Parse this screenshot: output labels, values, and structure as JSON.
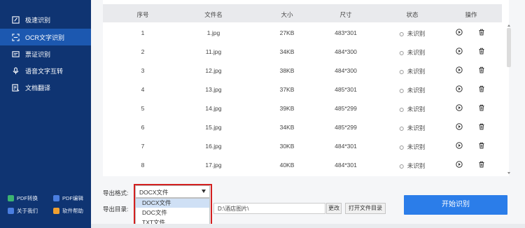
{
  "sidebar": {
    "items": [
      {
        "label": "极速识别",
        "icon": "edit-icon"
      },
      {
        "label": "OCR文字识别",
        "icon": "scan-icon"
      },
      {
        "label": "票证识别",
        "icon": "ticket-icon"
      },
      {
        "label": "语音文字互转",
        "icon": "mic-icon"
      },
      {
        "label": "文档翻译",
        "icon": "translate-icon"
      }
    ],
    "active_index": 1,
    "bottom_links": [
      {
        "label": "PDF转换",
        "color": "#3cb371"
      },
      {
        "label": "PDF编辑",
        "color": "#4a7ee0"
      },
      {
        "label": "关于我们",
        "color": "#4a7ee0"
      },
      {
        "label": "软件帮助",
        "color": "#f0a030"
      }
    ]
  },
  "table": {
    "headers": [
      "序号",
      "文件名",
      "大小",
      "尺寸",
      "状态",
      "操作"
    ],
    "rows": [
      {
        "index": "1",
        "name": "1.jpg",
        "size": "27KB",
        "dim": "483*301",
        "status": "未识别"
      },
      {
        "index": "2",
        "name": "11.jpg",
        "size": "34KB",
        "dim": "484*300",
        "status": "未识别"
      },
      {
        "index": "3",
        "name": "12.jpg",
        "size": "38KB",
        "dim": "484*300",
        "status": "未识别"
      },
      {
        "index": "4",
        "name": "13.jpg",
        "size": "37KB",
        "dim": "485*301",
        "status": "未识别"
      },
      {
        "index": "5",
        "name": "14.jpg",
        "size": "39KB",
        "dim": "485*299",
        "status": "未识别"
      },
      {
        "index": "6",
        "name": "15.jpg",
        "size": "34KB",
        "dim": "485*299",
        "status": "未识别"
      },
      {
        "index": "7",
        "name": "16.jpg",
        "size": "30KB",
        "dim": "484*301",
        "status": "未识别"
      },
      {
        "index": "8",
        "name": "17.jpg",
        "size": "40KB",
        "dim": "484*301",
        "status": "未识别"
      }
    ]
  },
  "export": {
    "format_label": "导出格式:",
    "format_value": "DOCX文件",
    "format_options": [
      "DOCX文件",
      "DOC文件",
      "TXT文件"
    ],
    "dir_label": "导出目录:",
    "dir_value": "D:\\酒店图片\\",
    "change_button": "更改",
    "open_dir_button": "打开文件目录",
    "start_button": "开始识别"
  },
  "colors": {
    "sidebar_bg": "#0f3472",
    "sidebar_active": "#1c58b0",
    "accent": "#2b7de9",
    "highlight": "#d42020"
  }
}
